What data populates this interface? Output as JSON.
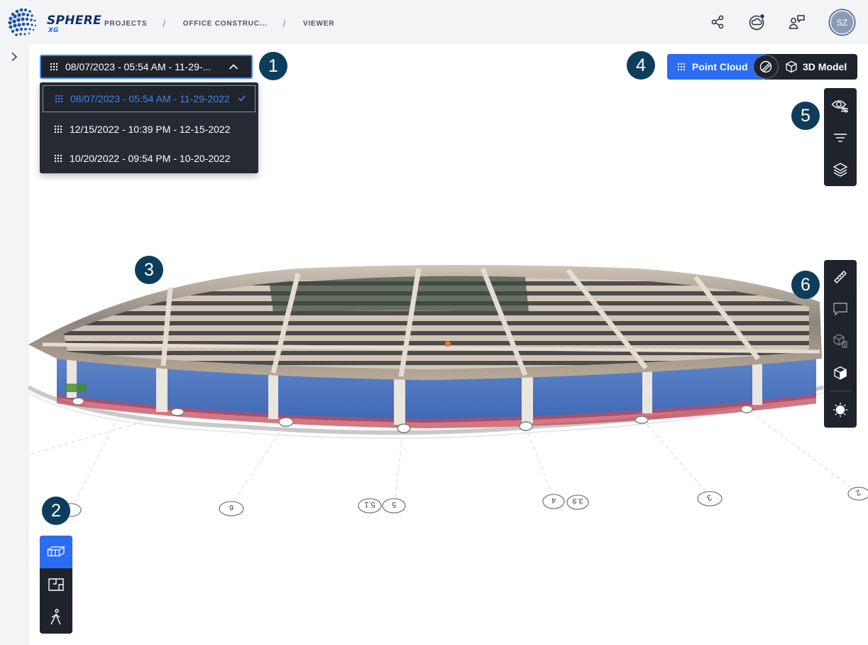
{
  "app": {
    "logo_text": "SPHERE",
    "logo_sub": "XG"
  },
  "breadcrumb": {
    "items": [
      "PROJECTS",
      "OFFICE CONSTRUC...",
      "VIEWER"
    ],
    "separator": "/"
  },
  "header_icons": [
    "share-icon",
    "cloud-notification-icon",
    "user-feedback-icon"
  ],
  "user": {
    "initials": "SZ"
  },
  "date_select": {
    "value": "08/07/2023 - 05:54 AM - 11-29-...",
    "options": [
      {
        "label": "08/07/2023 - 05:54 AM - 11-29-2022",
        "selected": true
      },
      {
        "label": "12/15/2022 - 10:39 PM - 12-15-2022",
        "selected": false
      },
      {
        "label": "10/20/2022 - 09:54 PM - 10-20-2022",
        "selected": false
      }
    ]
  },
  "mode_toggle": {
    "point_cloud_label": "Point Cloud",
    "model_label": "3D Model",
    "active": "Point Cloud"
  },
  "callouts": [
    "1",
    "2",
    "3",
    "4",
    "5",
    "6"
  ],
  "toolbar_visibility": [
    "eye-settings-icon",
    "filter-icon",
    "layers-icon"
  ],
  "toolbar_tools": [
    "ruler-icon",
    "comment-icon",
    "compare-icon",
    "cube-icon",
    "brightness-icon"
  ],
  "view_modes": [
    "3d-view-icon",
    "floorplan-icon",
    "walk-icon"
  ],
  "grid_labels": [
    "6",
    "5.1",
    "5",
    "4",
    "3.9",
    "3",
    "2"
  ],
  "colors": {
    "accent": "#2c6cf0",
    "focus": "#3b86f5",
    "panel": "#1f232b",
    "callout": "#0e3d5c",
    "brand": "#12306b"
  }
}
